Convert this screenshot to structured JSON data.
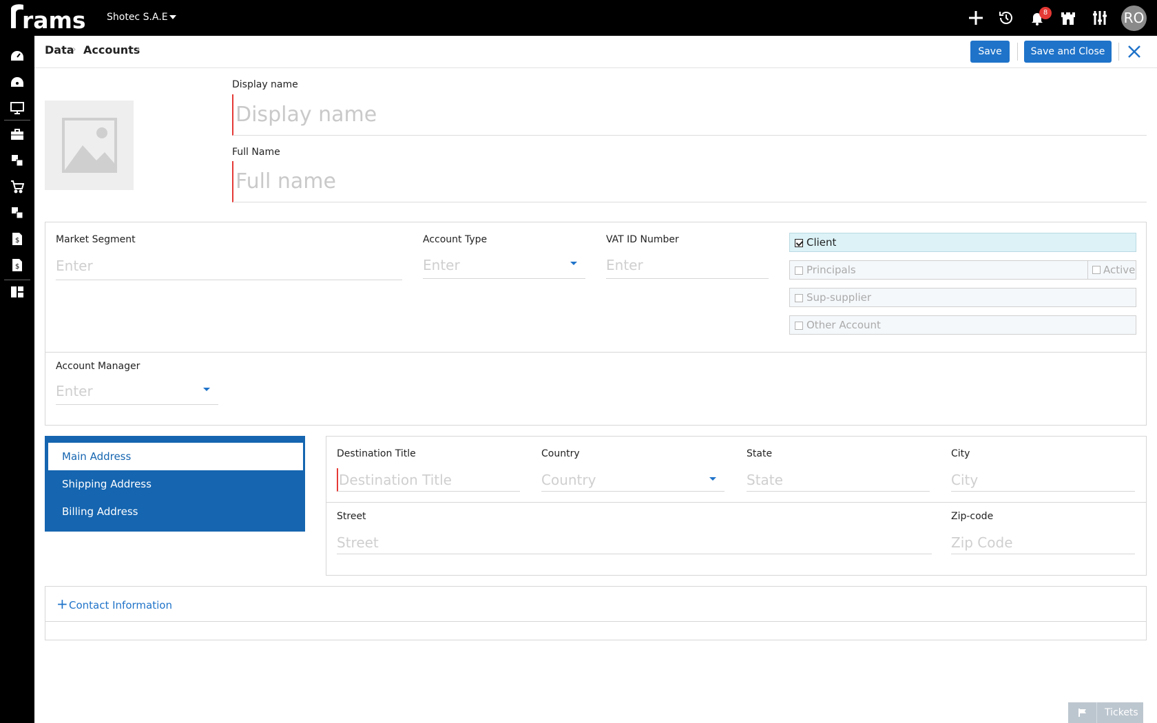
{
  "topbar": {
    "logo_text": "rams",
    "company": "Shotec S.A.E",
    "notification_count": "8",
    "avatar_initials": "RO",
    "icons": [
      "plus-icon",
      "history-icon",
      "bell-icon",
      "castle-icon",
      "sliders-icon"
    ]
  },
  "sidebar": {
    "icons": [
      "dashboard-icon",
      "speedometer-icon",
      "monitor-icon",
      "briefcase-icon",
      "data-icon",
      "cart-icon",
      "grid-icon",
      "invoice-icon",
      "payment-icon",
      "module-icon"
    ]
  },
  "breadcrumb": {
    "items": [
      "Data",
      "Accounts"
    ]
  },
  "actions": {
    "save": "Save",
    "save_close": "Save and Close"
  },
  "form": {
    "display_name": {
      "label": "Display name",
      "placeholder": "Display name",
      "value": ""
    },
    "full_name": {
      "label": "Full Name",
      "placeholder": "Full name",
      "value": ""
    },
    "market_segment": {
      "label": "Market Segment",
      "placeholder": "Enter"
    },
    "account_type": {
      "label": "Account Type",
      "placeholder": "Enter"
    },
    "vat_id": {
      "label": "VAT ID Number",
      "placeholder": "Enter"
    },
    "account_manager": {
      "label": "Account Manager",
      "placeholder": "Enter"
    },
    "checks": {
      "client": {
        "label": "Client",
        "checked": true
      },
      "principals": {
        "label": "Principals",
        "checked": false
      },
      "active": {
        "label": "Active",
        "checked": false
      },
      "sup_supplier": {
        "label": "Sup-supplier",
        "checked": false
      },
      "other_account": {
        "label": "Other Account",
        "checked": false
      }
    }
  },
  "address": {
    "tabs": [
      "Main Address",
      "Shipping Address",
      "Billing Address"
    ],
    "active_tab": "Main Address",
    "destination_title": {
      "label": "Destination Title",
      "placeholder": "Destination Title"
    },
    "country": {
      "label": "Country",
      "placeholder": "Country"
    },
    "state": {
      "label": "State",
      "placeholder": "State"
    },
    "city": {
      "label": "City",
      "placeholder": "City"
    },
    "street": {
      "label": "Street",
      "placeholder": "Street"
    },
    "zip": {
      "label": "Zip-code",
      "placeholder": "Zip Code"
    }
  },
  "contact": {
    "label": "Contact Information"
  },
  "tickets": {
    "label": "Tickets"
  },
  "colors": {
    "accent": "#1f73c9",
    "required": "#e53935",
    "topbar": "#000000",
    "tab_bg": "#1565b0"
  }
}
